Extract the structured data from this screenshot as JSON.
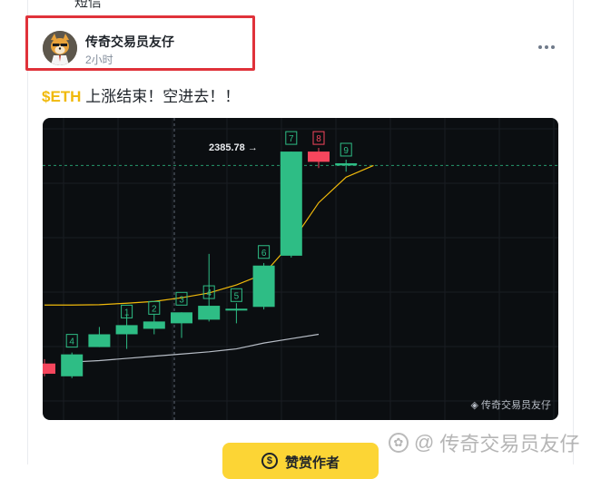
{
  "previous_post": {
    "tail_text": "短信"
  },
  "post": {
    "author": {
      "name": "传奇交易员友仔",
      "time": "2小时"
    },
    "text": {
      "ticker": "$ETH",
      "body": " 上涨结束！空进去！！"
    }
  },
  "chart_data": {
    "type": "candlestick",
    "title": "",
    "price_label": "2385.78 →",
    "watermark": "传奇交易员友仔",
    "candles": [
      {
        "label": "",
        "open": 1810,
        "high": 1822,
        "low": 1775,
        "close": 1782,
        "color": "red"
      },
      {
        "label": "4",
        "open": 1775,
        "high": 1840,
        "low": 1770,
        "close": 1835,
        "color": "green"
      },
      {
        "label": "",
        "open": 1855,
        "high": 1910,
        "low": 1855,
        "close": 1890,
        "color": "green"
      },
      {
        "label": "1",
        "open": 1890,
        "high": 1945,
        "low": 1850,
        "close": 1915,
        "color": "green"
      },
      {
        "label": "2",
        "open": 1905,
        "high": 1945,
        "low": 1890,
        "close": 1925,
        "color": "green"
      },
      {
        "label": "3",
        "open": 1920,
        "high": 1950,
        "low": 1880,
        "close": 1950,
        "color": "green"
      },
      {
        "label": "4",
        "open": 1930,
        "high": 2110,
        "low": 1925,
        "close": 1968,
        "color": "green"
      },
      {
        "label": "5",
        "open": 1955,
        "high": 1975,
        "low": 1920,
        "close": 1960,
        "color": "green"
      },
      {
        "label": "6",
        "open": 1965,
        "high": 2085,
        "low": 1958,
        "close": 2078,
        "color": "green"
      },
      {
        "label": "7",
        "open": 2105,
        "high": 2390,
        "low": 2100,
        "close": 2390,
        "color": "green"
      },
      {
        "label": "8",
        "open": 2390,
        "high": 2400,
        "low": 2345,
        "close": 2362,
        "color": "red"
      },
      {
        "label": "9",
        "open": 2358,
        "high": 2368,
        "low": 2335,
        "close": 2352,
        "color": "green"
      }
    ],
    "ma_fast": [
      1970,
      1970,
      1971,
      1975,
      1980,
      1990,
      2003,
      2025,
      2055,
      2140,
      2250,
      2320,
      2352
    ],
    "ma_slow": [
      1814,
      1818,
      1824,
      1830,
      1836,
      1842,
      1850,
      1866,
      1878,
      1890
    ],
    "current_price_line": 2352,
    "colors": {
      "up": "#2ebd85",
      "down": "#f6465d",
      "ma_fast": "#f0b90b",
      "ma_slow": "#b7bdc6"
    }
  },
  "tip_button": {
    "label": "赞赏作者",
    "icon": "$"
  },
  "page_watermark": {
    "prefix": "@",
    "text": "传奇交易员友仔"
  }
}
